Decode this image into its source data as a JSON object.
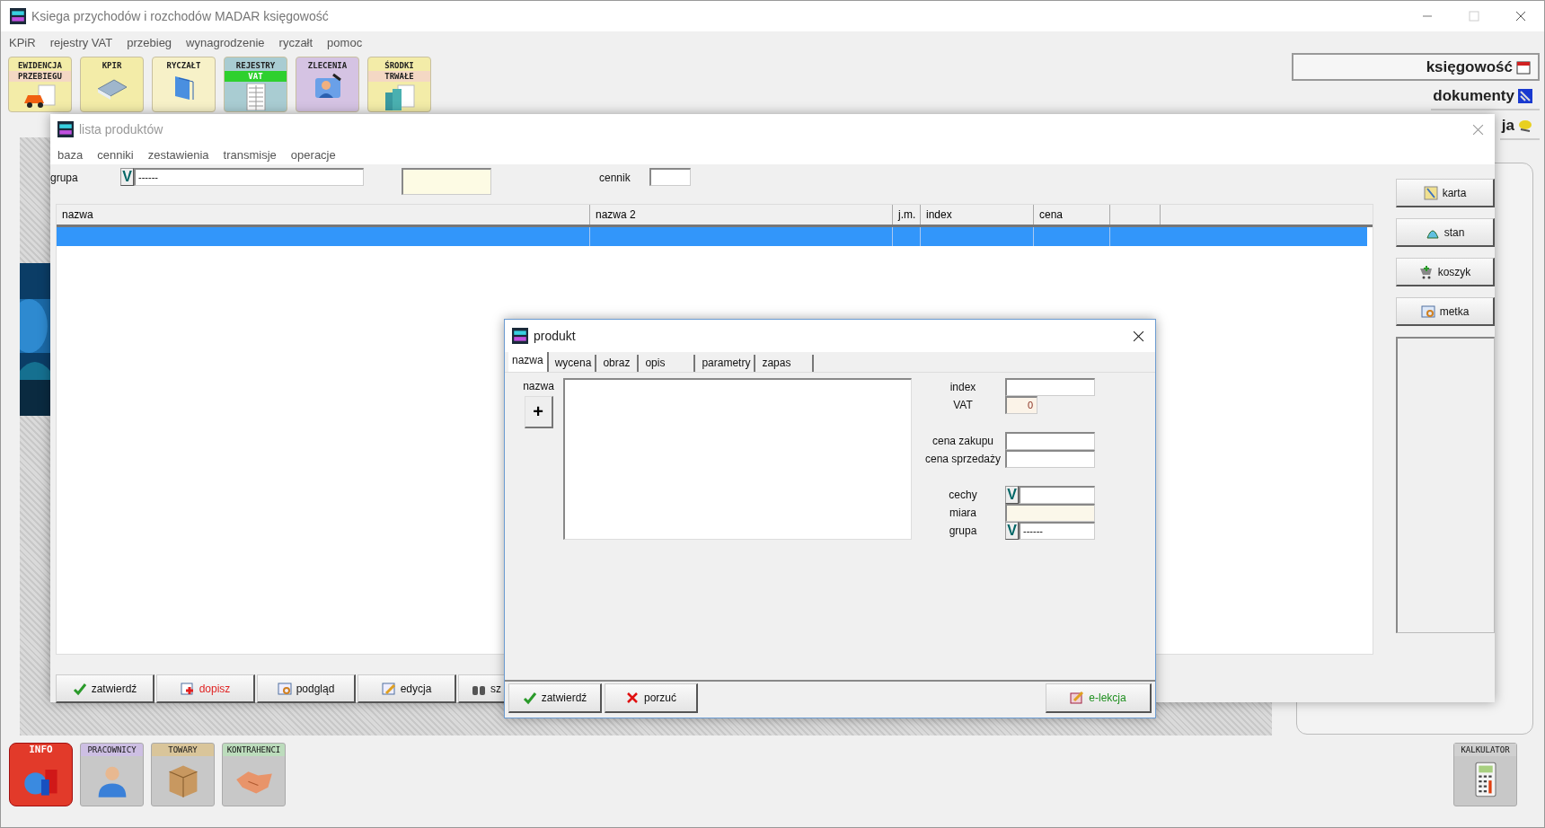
{
  "app_window": {
    "title": "Ksiega przychodów i rozchodów MADAR  księgowość",
    "menu": [
      "KPiR",
      "rejestry VAT",
      "przebieg",
      "wynagrodzenie",
      "ryczałt",
      "pomoc"
    ],
    "toolbar": [
      {
        "kind": "car",
        "lines": [
          "EWIDENCJA",
          "PRZEBIEGU"
        ],
        "color": "#f3eca8"
      },
      {
        "kind": "book",
        "lines": [
          "KPIR"
        ],
        "color": "#f3eca8"
      },
      {
        "kind": "folder",
        "lines": [
          "RYCZAŁT"
        ],
        "color": "#f7f1c8"
      },
      {
        "kind": "register",
        "lines": [
          "REJESTRY",
          "VAT"
        ],
        "color": "#a9ccd2"
      },
      {
        "kind": "orders",
        "lines": [
          "ZLECENIA"
        ],
        "color": "#d5c3e3"
      },
      {
        "kind": "assets",
        "lines": [
          "ŚRODKI",
          "TRWAŁE"
        ],
        "color": "#f3eca8"
      }
    ],
    "side_tabs": [
      {
        "label": "księgowość",
        "kind": "calendar",
        "selected": true
      },
      {
        "label": "dokumenty",
        "kind": "doc",
        "selected": false
      },
      {
        "label": "ja",
        "kind": "helmet",
        "selected": false
      }
    ],
    "bottom_tiles": [
      {
        "kind": "info",
        "label": "INFO",
        "color": "#e23a2a"
      },
      {
        "kind": "person",
        "label": "PRACOWNICY",
        "color": "#cdbfe3"
      },
      {
        "kind": "box",
        "label": "TOWARY",
        "color": "#d9c59a"
      },
      {
        "kind": "hands",
        "label": "KONTRAHENCI",
        "color": "#bcdcbc"
      }
    ],
    "calculator": {
      "label": "KALKULATOR"
    }
  },
  "product_list_window": {
    "title": "lista produktów",
    "menu": [
      "baza",
      "cenniki",
      "zestawienia",
      "transmisje",
      "operacje"
    ],
    "group": {
      "label": "grupa",
      "toggle": "V",
      "value": "------"
    },
    "price_list": {
      "label": "cennik"
    },
    "table": {
      "columns": [
        "nazwa",
        "nazwa 2",
        "j.m.",
        "index",
        "cena"
      ],
      "rows": [
        {
          "selected": true
        }
      ]
    },
    "side_buttons": [
      {
        "kind": "card",
        "label": "karta"
      },
      {
        "kind": "state",
        "label": "stan"
      },
      {
        "kind": "cart",
        "label": "koszyk"
      },
      {
        "kind": "tag",
        "label": "metka"
      }
    ],
    "bottom_buttons": [
      {
        "kind": "confirm",
        "label": "zatwierdź"
      },
      {
        "kind": "add",
        "label": "dopisz",
        "color": "#e02424"
      },
      {
        "kind": "preview",
        "label": "podgląd"
      },
      {
        "kind": "edit",
        "label": "edycja"
      },
      {
        "kind": "search",
        "label": "sz"
      }
    ]
  },
  "product_dialog": {
    "title": "produkt",
    "tabs": [
      {
        "label": "nazwa",
        "selected": true
      },
      {
        "label": "wycena",
        "selected": false
      },
      {
        "label": "obraz",
        "selected": false
      },
      {
        "label": "opis",
        "selected": false
      },
      {
        "label": "parametry",
        "selected": false
      },
      {
        "label": "zapas",
        "selected": false
      }
    ],
    "name_label": "nazwa",
    "add_button": "+",
    "fields": [
      {
        "label": "index",
        "kind": "text"
      },
      {
        "label": "VAT",
        "kind": "number",
        "value": "0"
      },
      {
        "label": "cena zakupu",
        "kind": "text",
        "gap": true
      },
      {
        "label": "cena sprzedaży",
        "kind": "text"
      },
      {
        "label": "cechy",
        "kind": "toggle",
        "toggle": "V",
        "gap": true
      },
      {
        "label": "miara",
        "kind": "readonly"
      },
      {
        "label": "grupa",
        "kind": "toggle",
        "toggle": "V",
        "value": "------"
      }
    ],
    "buttons": [
      {
        "kind": "confirm",
        "label": "zatwierdź"
      },
      {
        "kind": "cancel",
        "label": "porzuć"
      },
      {
        "kind": "lesson",
        "label": "e-lekcja",
        "color": "#1f8f1f"
      }
    ]
  }
}
